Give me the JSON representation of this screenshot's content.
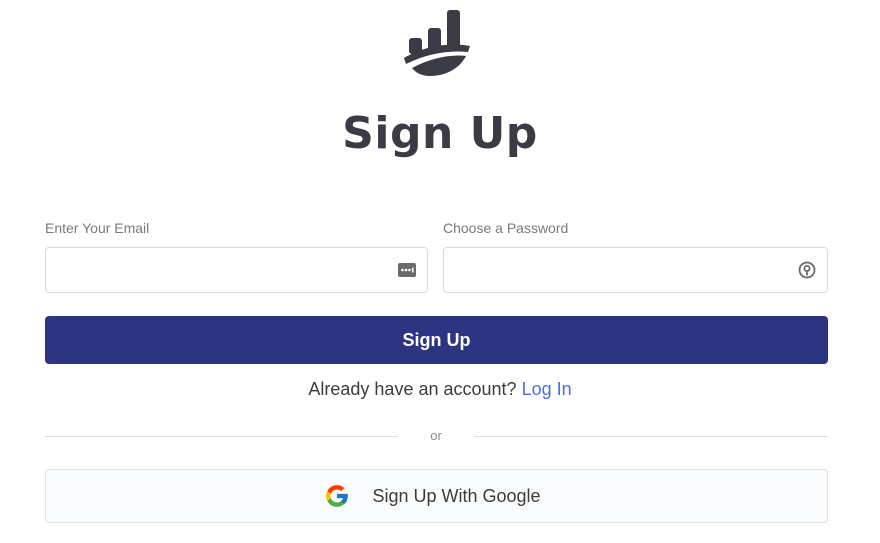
{
  "header": {
    "title": "Sign Up"
  },
  "form": {
    "email": {
      "label": "Enter Your Email",
      "value": "",
      "placeholder": ""
    },
    "password": {
      "label": "Choose a Password",
      "value": "",
      "placeholder": ""
    },
    "submit_label": "Sign Up"
  },
  "login": {
    "prompt": "Already have an account?",
    "link_label": "Log In"
  },
  "divider": {
    "text": "or"
  },
  "google": {
    "label": "Sign Up With Google"
  },
  "icons": {
    "logo": "ship-logo-icon",
    "email_field": "autofill-card-icon",
    "password_field": "password-manager-icon",
    "google": "google-icon"
  },
  "colors": {
    "primary_button": "#2d3482",
    "link": "#4a70e0",
    "title": "#3b3b45"
  }
}
